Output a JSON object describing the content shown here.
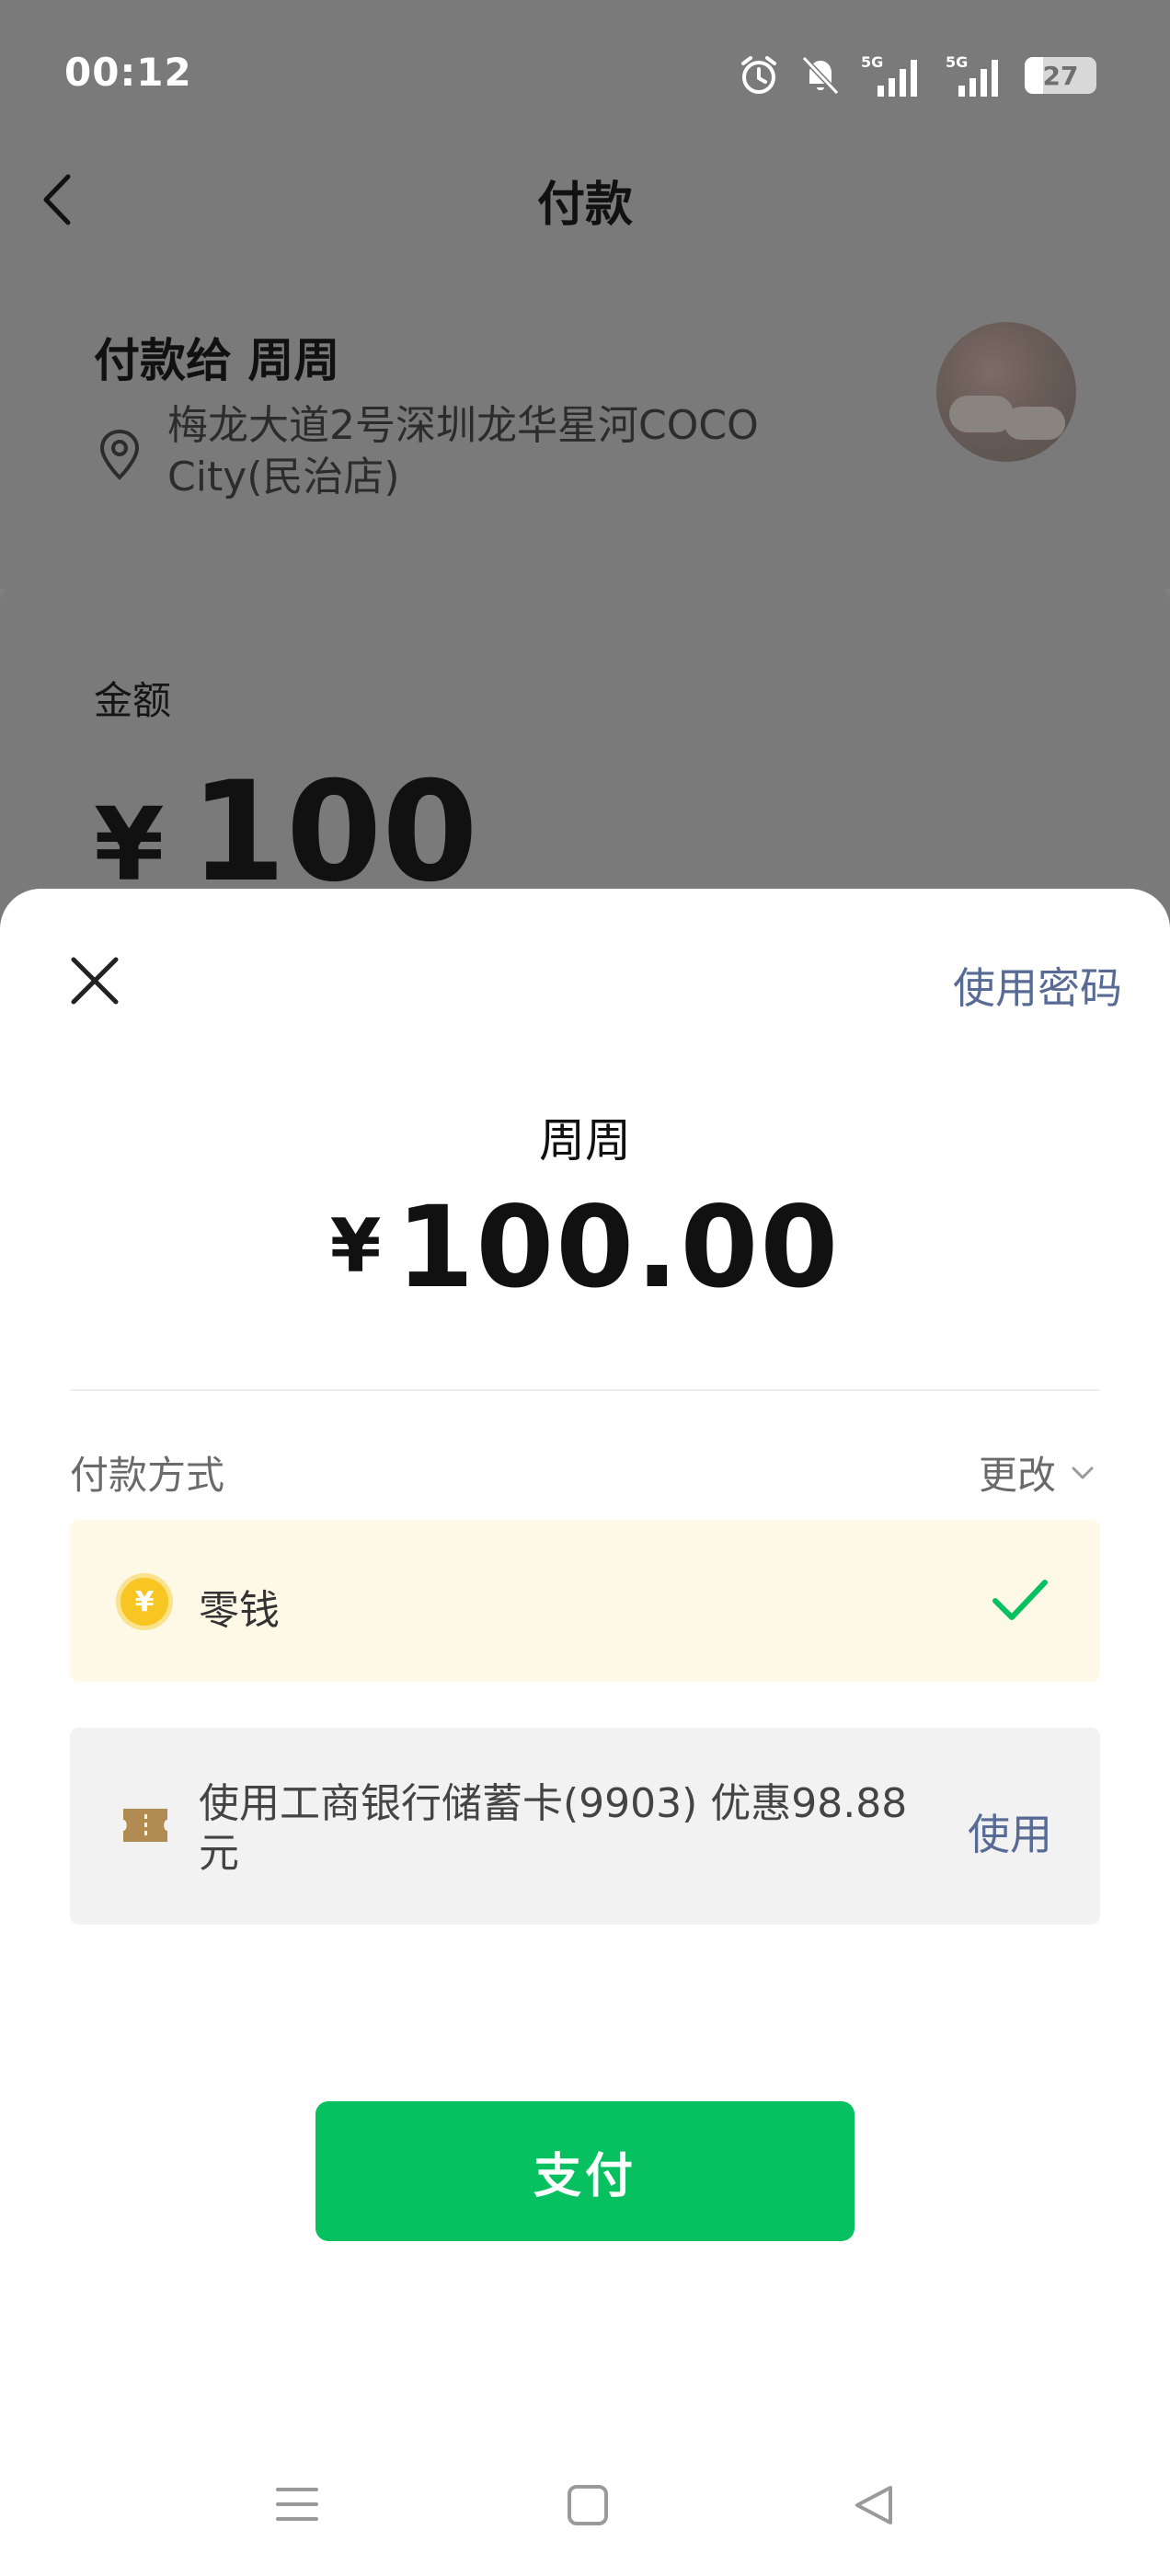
{
  "status_bar": {
    "time": "00:12",
    "battery_level": "27",
    "network_1": "5G",
    "network_2": "5G",
    "icons": [
      "alarm-icon",
      "bell-muted-icon",
      "signal-5g-icon",
      "signal-5g-icon",
      "battery-icon"
    ]
  },
  "header": {
    "title": "付款",
    "back_icon": "chevron-left-icon"
  },
  "payee": {
    "title": "付款给 周周",
    "address": "梅龙大道2号深圳龙华星河COCO City(民治店)",
    "location_icon": "location-pin-icon"
  },
  "amount_section": {
    "label": "金额",
    "currency": "¥",
    "value": "100"
  },
  "sheet": {
    "close_icon": "close-icon",
    "use_password": "使用密码",
    "recipient": "周周",
    "currency": "¥",
    "amount": "100.00",
    "payment_method_label": "付款方式",
    "change_label": "更改",
    "options": [
      {
        "label": "零钱",
        "icon": "coin-icon",
        "coin_symbol": "¥",
        "selected": true
      },
      {
        "label": "使用工商银行储蓄卡(9903) 优惠98.88元",
        "icon": "coupon-icon",
        "action": "使用"
      }
    ],
    "pay_button": "支付"
  },
  "colors": {
    "primary_green": "#07c160",
    "link_blue": "#576b95",
    "selected_bg": "#fef8e7",
    "check_green": "#07c160"
  },
  "nav_bar": {
    "icons": [
      "menu-icon",
      "home-square-icon",
      "back-triangle-icon"
    ]
  }
}
